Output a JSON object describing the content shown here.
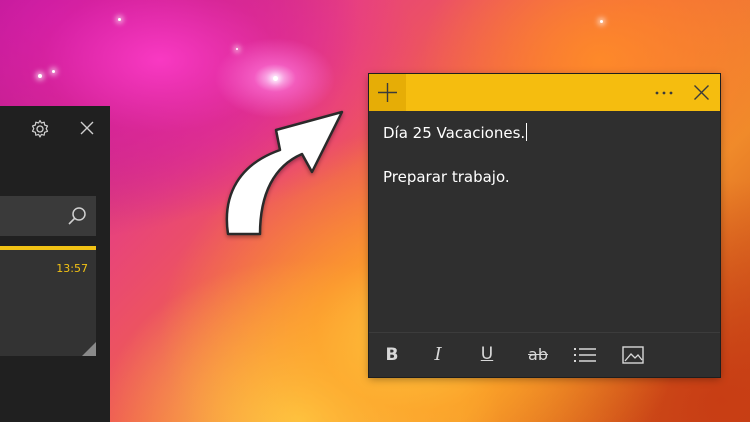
{
  "notes_list": {
    "search": {
      "value": "",
      "placeholder": ""
    },
    "note": {
      "time": "13:57"
    },
    "icons": [
      "gear-icon",
      "close-icon",
      "search-icon"
    ]
  },
  "sticky_note": {
    "title_line": "Día 25 Vacaciones.",
    "body_line": "Preparar trabajo.",
    "titlebar": {
      "add_icon": "plus-icon",
      "menu_icon": "more-icon",
      "close_icon": "close-icon"
    },
    "toolbar": {
      "bold": "B",
      "italic": "I",
      "underline": "U",
      "strikethrough": "ab",
      "list_icon": "bullet-list-icon",
      "image_icon": "image-icon"
    }
  },
  "colors": {
    "note_accent": "#f5bd0f",
    "note_background": "#2f2f2f",
    "list_background": "#202020"
  }
}
